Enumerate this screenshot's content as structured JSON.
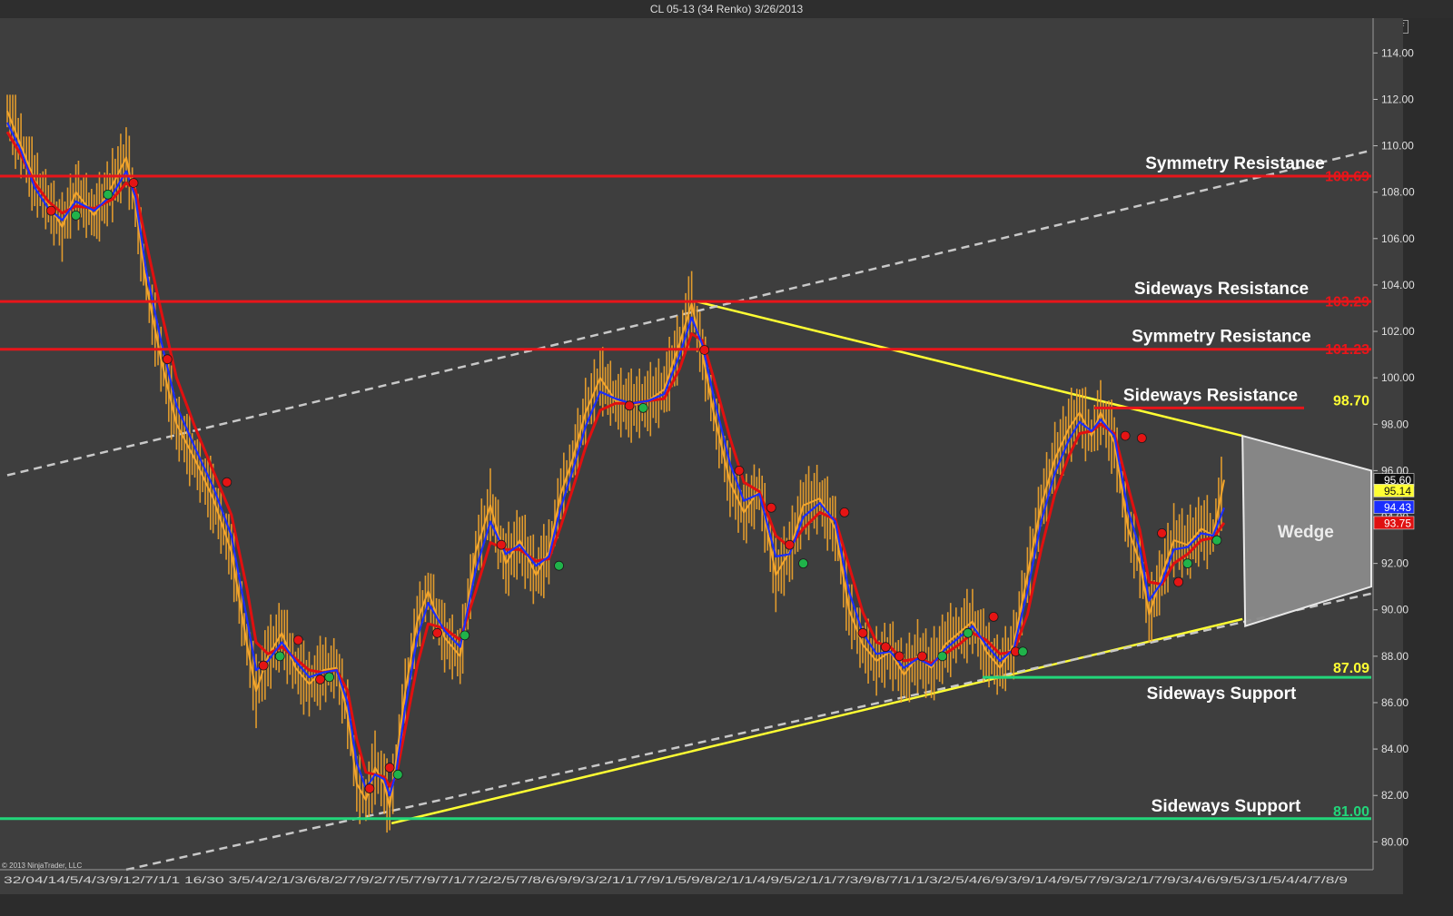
{
  "window": {
    "title": "CL 05-13 (34 Renko)  3/26/2013",
    "float_button": "F",
    "skip_icon": "skip-to-end-icon"
  },
  "copyright": "© 2013 NinjaTrader, LLC",
  "date_strip": "32/04/14/5/4/3/9/12/7/1/1 16/30 3/5/4/2/1/3/6/8/2/7/9/2/7/5/7/9/7/1/7/2/2/5/7/8/6/9/9/3/2/1/1/7/9/1/5/9/8/2/1/1/4/9/5/2/1/1/7/3/9/8/7/1/1/3/2/5/4/6/9/3/9/1/4/9/5/7/9/3/2/1/7/9/3/4/6/9/5/3/1/5/4/4/7/8/9",
  "colors": {
    "background": "#3e3e3e",
    "resistance": "#e8151a",
    "support": "#22d67a",
    "trendline": "#ffff33",
    "channel": "#c8c8c8",
    "price": "#f3a52b",
    "ma_fast": "#1a2eff",
    "ma_slow": "#e01010",
    "signal_buy": "#20b34a",
    "signal_sell": "#e51414",
    "label_text": "#ffffff",
    "wedge_fill": "#8a8a8a"
  },
  "chart_data": {
    "type": "line",
    "instrument": "CL 05-13",
    "bar_type": "34 Renko",
    "ylim": [
      78.8,
      115.5
    ],
    "yticks": [
      80,
      82,
      84,
      86,
      88,
      90,
      92,
      94,
      96,
      98,
      100,
      102,
      104,
      106,
      108,
      110,
      112,
      114
    ],
    "ytick_labels": [
      "80.00",
      "82.00",
      "84.00",
      "86.00",
      "88.00",
      "90.00",
      "92.00",
      "94.00",
      "96.00",
      "98.00",
      "100.00",
      "102.00",
      "104.00",
      "106.00",
      "108.00",
      "110.00",
      "112.00",
      "114.00"
    ],
    "bar_count": 1330,
    "series": [
      {
        "type": "line",
        "color": "#f3a52b",
        "x": [
          0,
          15,
          30,
          45,
          60,
          75,
          95,
          115,
          130,
          140,
          152,
          168,
          185,
          205,
          225,
          245,
          262,
          272,
          285,
          300,
          315,
          330,
          345,
          360,
          372,
          382,
          392,
          402,
          412,
          418,
          425,
          435,
          448,
          460,
          478,
          495,
          512,
          528,
          545,
          560,
          578,
          592,
          605,
          618,
          632,
          648,
          665,
          682,
          700,
          718,
          735,
          748,
          760,
          772,
          790,
          805,
          822,
          840,
          855,
          870,
          888,
          905,
          920,
          935,
          950,
          965,
          980,
          995,
          1010,
          1025,
          1040,
          1055,
          1070,
          1085,
          1100,
          1115,
          1130,
          1145,
          1160,
          1172,
          1185,
          1195,
          1210,
          1225,
          1238,
          1248,
          1262,
          1275,
          1290,
          1305,
          1318,
          1330
        ],
        "values": [
          111.5,
          110.0,
          108.5,
          107.5,
          106.5,
          108.0,
          107.0,
          108.3,
          109.5,
          107.5,
          104.0,
          100.8,
          98.0,
          96.5,
          94.8,
          92.5,
          88.5,
          86.5,
          88.0,
          89.0,
          87.5,
          86.8,
          87.4,
          87.5,
          85.5,
          82.5,
          81.8,
          83.2,
          82.5,
          81.5,
          83.5,
          86.5,
          89.5,
          90.8,
          88.8,
          88.0,
          92.5,
          94.5,
          92.0,
          93.0,
          91.5,
          92.5,
          95.0,
          96.5,
          98.5,
          100.0,
          99.0,
          98.8,
          99.0,
          99.5,
          101.5,
          103.2,
          101.0,
          98.5,
          95.5,
          94.2,
          95.2,
          91.5,
          92.5,
          94.5,
          94.8,
          93.5,
          90.0,
          88.5,
          87.8,
          88.2,
          87.2,
          88.0,
          87.5,
          88.5,
          89.0,
          89.5,
          88.2,
          87.5,
          88.5,
          91.5,
          94.5,
          96.5,
          97.8,
          98.5,
          97.5,
          98.5,
          97.2,
          93.5,
          92.0,
          89.8,
          91.5,
          93.0,
          92.8,
          93.5,
          93.2,
          95.6
        ]
      },
      {
        "type": "line",
        "color": "#1a2eff",
        "x": [
          0,
          15,
          30,
          45,
          60,
          75,
          95,
          115,
          130,
          140,
          152,
          168,
          185,
          205,
          225,
          245,
          262,
          272,
          285,
          300,
          315,
          330,
          345,
          360,
          372,
          382,
          392,
          402,
          412,
          418,
          425,
          435,
          448,
          460,
          478,
          495,
          512,
          528,
          545,
          560,
          578,
          592,
          605,
          618,
          632,
          648,
          665,
          682,
          700,
          718,
          735,
          748,
          760,
          772,
          790,
          805,
          822,
          840,
          855,
          870,
          888,
          905,
          920,
          935,
          950,
          965,
          980,
          995,
          1010,
          1025,
          1040,
          1055,
          1070,
          1085,
          1100,
          1115,
          1130,
          1145,
          1160,
          1172,
          1185,
          1195,
          1210,
          1225,
          1238,
          1248,
          1262,
          1275,
          1290,
          1305,
          1318,
          1330
        ],
        "values": [
          111.0,
          109.8,
          108.2,
          107.3,
          106.8,
          107.6,
          107.2,
          107.9,
          108.9,
          107.8,
          104.6,
          101.6,
          98.8,
          97.0,
          95.3,
          93.2,
          89.6,
          87.4,
          87.8,
          88.6,
          87.8,
          87.1,
          87.3,
          87.4,
          86.0,
          83.4,
          82.3,
          82.9,
          82.7,
          82.0,
          83.0,
          85.8,
          88.8,
          90.3,
          89.1,
          88.4,
          91.7,
          93.8,
          92.4,
          92.8,
          91.9,
          92.3,
          94.4,
          96.0,
          97.9,
          99.4,
          99.1,
          98.9,
          99.0,
          99.3,
          101.0,
          102.6,
          101.4,
          99.2,
          96.3,
          94.7,
          95.0,
          92.3,
          92.4,
          94.0,
          94.6,
          93.8,
          90.8,
          89.0,
          88.1,
          88.2,
          87.5,
          87.9,
          87.6,
          88.3,
          88.8,
          89.3,
          88.5,
          87.8,
          88.3,
          90.8,
          93.8,
          95.9,
          97.3,
          98.1,
          97.7,
          98.2,
          97.5,
          94.3,
          92.6,
          90.4,
          91.2,
          92.6,
          92.7,
          93.3,
          93.2,
          94.4
        ]
      },
      {
        "type": "line",
        "color": "#e01010",
        "x": [
          0,
          15,
          30,
          45,
          60,
          75,
          95,
          115,
          130,
          140,
          152,
          168,
          185,
          205,
          225,
          245,
          262,
          272,
          285,
          300,
          315,
          330,
          345,
          360,
          372,
          382,
          392,
          402,
          412,
          418,
          425,
          435,
          448,
          460,
          478,
          495,
          512,
          528,
          545,
          560,
          578,
          592,
          605,
          618,
          632,
          648,
          665,
          682,
          700,
          718,
          735,
          748,
          760,
          772,
          790,
          805,
          822,
          840,
          855,
          870,
          888,
          905,
          920,
          935,
          950,
          965,
          980,
          995,
          1010,
          1025,
          1040,
          1055,
          1070,
          1085,
          1100,
          1115,
          1130,
          1145,
          1160,
          1172,
          1185,
          1195,
          1210,
          1225,
          1238,
          1248,
          1262,
          1275,
          1290,
          1305,
          1318,
          1330
        ],
        "values": [
          110.6,
          109.6,
          108.4,
          107.6,
          107.1,
          107.4,
          107.3,
          107.7,
          108.4,
          108.1,
          105.8,
          102.9,
          100.0,
          97.9,
          96.0,
          94.1,
          90.9,
          88.6,
          88.1,
          88.4,
          87.9,
          87.4,
          87.3,
          87.4,
          86.5,
          84.4,
          83.0,
          82.9,
          82.8,
          82.4,
          82.8,
          84.9,
          87.6,
          89.4,
          89.2,
          88.7,
          90.8,
          92.9,
          92.6,
          92.6,
          92.1,
          92.2,
          93.6,
          95.2,
          97.0,
          98.6,
          98.9,
          98.9,
          99.0,
          99.1,
          100.4,
          101.9,
          101.6,
          100.0,
          97.4,
          95.5,
          95.1,
          93.2,
          92.7,
          93.5,
          94.2,
          93.9,
          91.9,
          89.9,
          88.6,
          88.4,
          87.8,
          87.9,
          87.7,
          88.1,
          88.5,
          89.0,
          88.7,
          88.1,
          88.2,
          89.8,
          92.6,
          95.0,
          96.6,
          97.6,
          97.7,
          98.0,
          97.6,
          95.3,
          93.4,
          91.2,
          91.1,
          92.0,
          92.4,
          93.0,
          93.1,
          93.75
        ]
      }
    ],
    "horizontal_levels": [
      {
        "label": "Symmetry Resistance",
        "value": 108.69,
        "value_label": "108.69",
        "type": "resistance"
      },
      {
        "label": "Sideways Resistance",
        "value": 103.29,
        "value_label": "103.29",
        "type": "resistance"
      },
      {
        "label": "Symmetry Resistance",
        "value": 101.23,
        "value_label": "101.23",
        "type": "resistance"
      },
      {
        "label": "Sideways Resistance",
        "value": 98.7,
        "value_label": "98.70",
        "type": "resistance_short"
      },
      {
        "label": "Sideways Support",
        "value": 87.09,
        "value_label": "87.09",
        "type": "support_short"
      },
      {
        "label": "Sideways Support",
        "value": 81.0,
        "value_label": "81.00",
        "type": "support"
      }
    ],
    "trendlines": [
      {
        "type": "yellow",
        "from": {
          "x": 752,
          "y": 103.3
        },
        "to": {
          "x": 1350,
          "y": 97.5
        }
      },
      {
        "type": "yellow",
        "from": {
          "x": 420,
          "y": 80.8
        },
        "to": {
          "x": 1350,
          "y": 89.6
        }
      },
      {
        "type": "dashed",
        "from": {
          "x": 0,
          "y": 95.8
        },
        "to": {
          "x": 1510,
          "y": 109.8
        }
      },
      {
        "type": "dashed",
        "from": {
          "x": 130,
          "y": 78.8
        },
        "to": {
          "x": 1510,
          "y": 90.7
        }
      }
    ],
    "wedge": {
      "label": "Wedge",
      "points": [
        {
          "x": 1350,
          "y": 97.5
        },
        {
          "x": 1510,
          "y": 96.0
        },
        {
          "x": 1510,
          "y": 91.0
        },
        {
          "x": 1353,
          "y": 89.3
        }
      ]
    },
    "current_price_labels": [
      {
        "value": 95.6,
        "text": "95.60",
        "bg": "#111111",
        "fg": "#ffffff"
      },
      {
        "value": 95.14,
        "text": "95.14",
        "bg": "#ffff33",
        "fg": "#111111"
      },
      {
        "value": 94.43,
        "text": "94.43",
        "bg": "#1a2eff",
        "fg": "#ffffff"
      },
      {
        "value": 93.75,
        "text": "93.75",
        "bg": "#e01010",
        "fg": "#ffffff"
      }
    ],
    "signals": [
      {
        "x": 48,
        "y": 107.2,
        "kind": "sell"
      },
      {
        "x": 75,
        "y": 107.0,
        "kind": "buy"
      },
      {
        "x": 110,
        "y": 107.9,
        "kind": "buy"
      },
      {
        "x": 138,
        "y": 108.4,
        "kind": "sell"
      },
      {
        "x": 175,
        "y": 100.8,
        "kind": "sell"
      },
      {
        "x": 240,
        "y": 95.5,
        "kind": "sell"
      },
      {
        "x": 280,
        "y": 87.6,
        "kind": "sell"
      },
      {
        "x": 298,
        "y": 88.0,
        "kind": "buy"
      },
      {
        "x": 318,
        "y": 88.7,
        "kind": "sell"
      },
      {
        "x": 342,
        "y": 87.0,
        "kind": "sell"
      },
      {
        "x": 352,
        "y": 87.1,
        "kind": "buy"
      },
      {
        "x": 396,
        "y": 82.3,
        "kind": "sell"
      },
      {
        "x": 418,
        "y": 83.2,
        "kind": "sell"
      },
      {
        "x": 427,
        "y": 82.9,
        "kind": "buy"
      },
      {
        "x": 470,
        "y": 89.0,
        "kind": "sell"
      },
      {
        "x": 500,
        "y": 88.9,
        "kind": "buy"
      },
      {
        "x": 540,
        "y": 92.8,
        "kind": "sell"
      },
      {
        "x": 603,
        "y": 91.9,
        "kind": "buy"
      },
      {
        "x": 680,
        "y": 98.8,
        "kind": "sell"
      },
      {
        "x": 695,
        "y": 98.7,
        "kind": "buy"
      },
      {
        "x": 762,
        "y": 101.2,
        "kind": "sell"
      },
      {
        "x": 800,
        "y": 96.0,
        "kind": "sell"
      },
      {
        "x": 835,
        "y": 94.4,
        "kind": "sell"
      },
      {
        "x": 855,
        "y": 92.8,
        "kind": "sell"
      },
      {
        "x": 870,
        "y": 92.0,
        "kind": "buy"
      },
      {
        "x": 915,
        "y": 94.2,
        "kind": "sell"
      },
      {
        "x": 935,
        "y": 89.0,
        "kind": "sell"
      },
      {
        "x": 960,
        "y": 88.4,
        "kind": "sell"
      },
      {
        "x": 975,
        "y": 88.0,
        "kind": "sell"
      },
      {
        "x": 1000,
        "y": 88.0,
        "kind": "sell"
      },
      {
        "x": 1022,
        "y": 88.0,
        "kind": "buy"
      },
      {
        "x": 1050,
        "y": 89.0,
        "kind": "buy"
      },
      {
        "x": 1078,
        "y": 89.7,
        "kind": "sell"
      },
      {
        "x": 1102,
        "y": 88.2,
        "kind": "sell"
      },
      {
        "x": 1110,
        "y": 88.2,
        "kind": "buy"
      },
      {
        "x": 1222,
        "y": 97.5,
        "kind": "sell"
      },
      {
        "x": 1240,
        "y": 97.4,
        "kind": "sell"
      },
      {
        "x": 1262,
        "y": 93.3,
        "kind": "sell"
      },
      {
        "x": 1280,
        "y": 91.2,
        "kind": "sell"
      },
      {
        "x": 1290,
        "y": 92.0,
        "kind": "buy"
      },
      {
        "x": 1322,
        "y": 93.0,
        "kind": "buy"
      }
    ]
  }
}
